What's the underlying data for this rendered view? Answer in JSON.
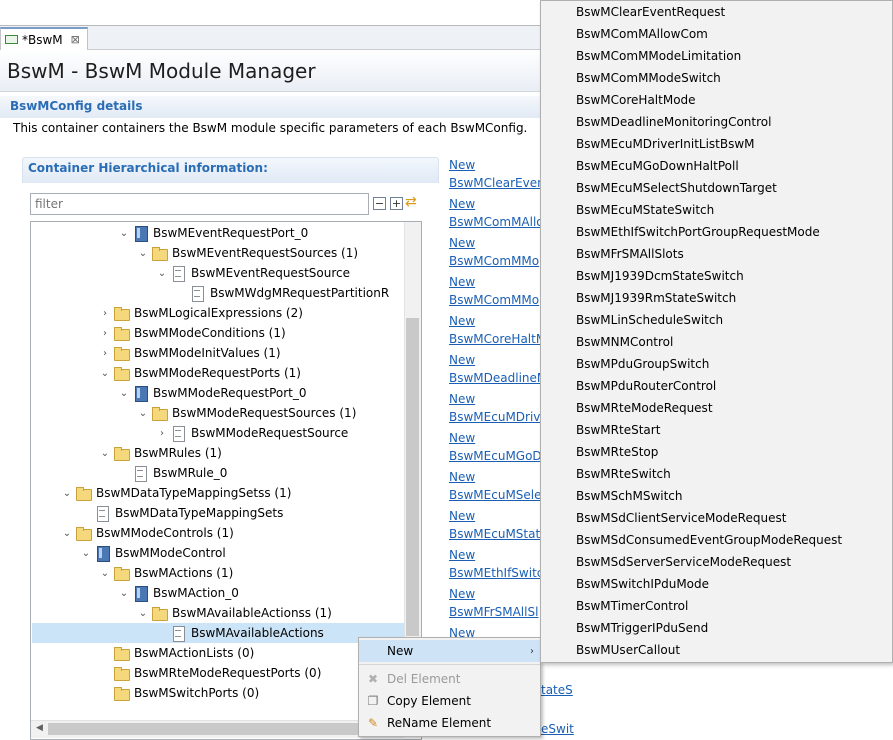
{
  "editor_tab": {
    "label": "*BswM",
    "close": "⊠"
  },
  "page_title": "BswM - BswM Module Manager",
  "section": {
    "title": "BswMConfig details",
    "description": "This container containers the BswM module specific parameters of each BswMConfig."
  },
  "hierarchy": {
    "title": "Container Hierarchical information:",
    "filter_placeholder": "filter",
    "collapse_label": "−",
    "expand_label": "+",
    "sync_icon": "⇄"
  },
  "tree": {
    "nodes": [
      {
        "label": "BswMEventRequestPort_0",
        "twisty": "⌄",
        "icon": "container"
      },
      {
        "label": "BswMEventRequestSources (1)",
        "twisty": "⌄",
        "icon": "folder"
      },
      {
        "label": "BswMEventRequestSource",
        "twisty": "⌄",
        "icon": "param"
      },
      {
        "label": "BswMWdgMRequestPartitionR",
        "twisty": "",
        "icon": "param"
      },
      {
        "label": "BswMLogicalExpressions (2)",
        "twisty": "›",
        "icon": "folder"
      },
      {
        "label": "BswMModeConditions (1)",
        "twisty": "›",
        "icon": "folder"
      },
      {
        "label": "BswMModeInitValues (1)",
        "twisty": "›",
        "icon": "folder"
      },
      {
        "label": "BswMModeRequestPorts (1)",
        "twisty": "⌄",
        "icon": "folder"
      },
      {
        "label": "BswMModeRequestPort_0",
        "twisty": "⌄",
        "icon": "container"
      },
      {
        "label": "BswMModeRequestSources (1)",
        "twisty": "⌄",
        "icon": "folder"
      },
      {
        "label": "BswMModeRequestSource",
        "twisty": "›",
        "icon": "param"
      },
      {
        "label": "BswMRules (1)",
        "twisty": "⌄",
        "icon": "folder"
      },
      {
        "label": "BswMRule_0",
        "twisty": "",
        "icon": "param"
      },
      {
        "label": "BswMDataTypeMappingSetss (1)",
        "twisty": "⌄",
        "icon": "folder"
      },
      {
        "label": "BswMDataTypeMappingSets",
        "twisty": "",
        "icon": "param"
      },
      {
        "label": "BswMModeControls (1)",
        "twisty": "⌄",
        "icon": "folder"
      },
      {
        "label": "BswMModeControl",
        "twisty": "⌄",
        "icon": "container"
      },
      {
        "label": "BswMActions (1)",
        "twisty": "⌄",
        "icon": "folder"
      },
      {
        "label": "BswMAction_0",
        "twisty": "⌄",
        "icon": "container"
      },
      {
        "label": "BswMAvailableActionss (1)",
        "twisty": "⌄",
        "icon": "folder"
      },
      {
        "label": "BswMAvailableActions",
        "twisty": "",
        "icon": "param"
      },
      {
        "label": "BswMActionLists (0)",
        "twisty": "",
        "icon": "folder"
      },
      {
        "label": "BswMRteModeRequestPorts (0)",
        "twisty": "",
        "icon": "folder"
      },
      {
        "label": "BswMSwitchPorts (0)",
        "twisty": "",
        "icon": "folder"
      }
    ]
  },
  "new_links": [
    "New",
    "BswMClearEvent",
    "New",
    "BswMComMAllo",
    "New",
    "BswMComMMo",
    "New",
    "BswMComMMo",
    "New",
    "BswMCoreHaltM",
    "New",
    "BswMDeadlineM",
    "New",
    "BswMEcuMDriv",
    "New",
    "BswMEcuMGoD",
    "New",
    "BswMEcuMSele",
    "New",
    "BswMEcuMState",
    "New",
    "BswMEthIfSwitc",
    "New",
    "BswMFrSMAllSl",
    "New",
    "tateS",
    "eSwit"
  ],
  "context_menu": {
    "new": "New",
    "del": "Del Element",
    "copy": "Copy Element",
    "rename": "ReName Element"
  },
  "submenu_items": [
    "BswMClearEventRequest",
    "BswMComMAllowCom",
    "BswMComMModeLimitation",
    "BswMComMModeSwitch",
    "BswMCoreHaltMode",
    "BswMDeadlineMonitoringControl",
    "BswMEcuMDriverInitListBswM",
    "BswMEcuMGoDownHaltPoll",
    "BswMEcuMSelectShutdownTarget",
    "BswMEcuMStateSwitch",
    "BswMEthIfSwitchPortGroupRequestMode",
    "BswMFrSMAllSlots",
    "BswMJ1939DcmStateSwitch",
    "BswMJ1939RmStateSwitch",
    "BswMLinScheduleSwitch",
    "BswMNMControl",
    "BswMPduGroupSwitch",
    "BswMPduRouterControl",
    "BswMRteModeRequest",
    "BswMRteStart",
    "BswMRteStop",
    "BswMRteSwitch",
    "BswMSchMSwitch",
    "BswMSdClientServiceModeRequest",
    "BswMSdConsumedEventGroupModeRequest",
    "BswMSdServerServiceModeRequest",
    "BswMSwitchIPduMode",
    "BswMTimerControl",
    "BswMTriggerIPduSend",
    "BswMUserCallout"
  ],
  "colors": {
    "accent": "#2a6db5",
    "link": "#1a5fb4",
    "selection": "#cce4f7"
  }
}
